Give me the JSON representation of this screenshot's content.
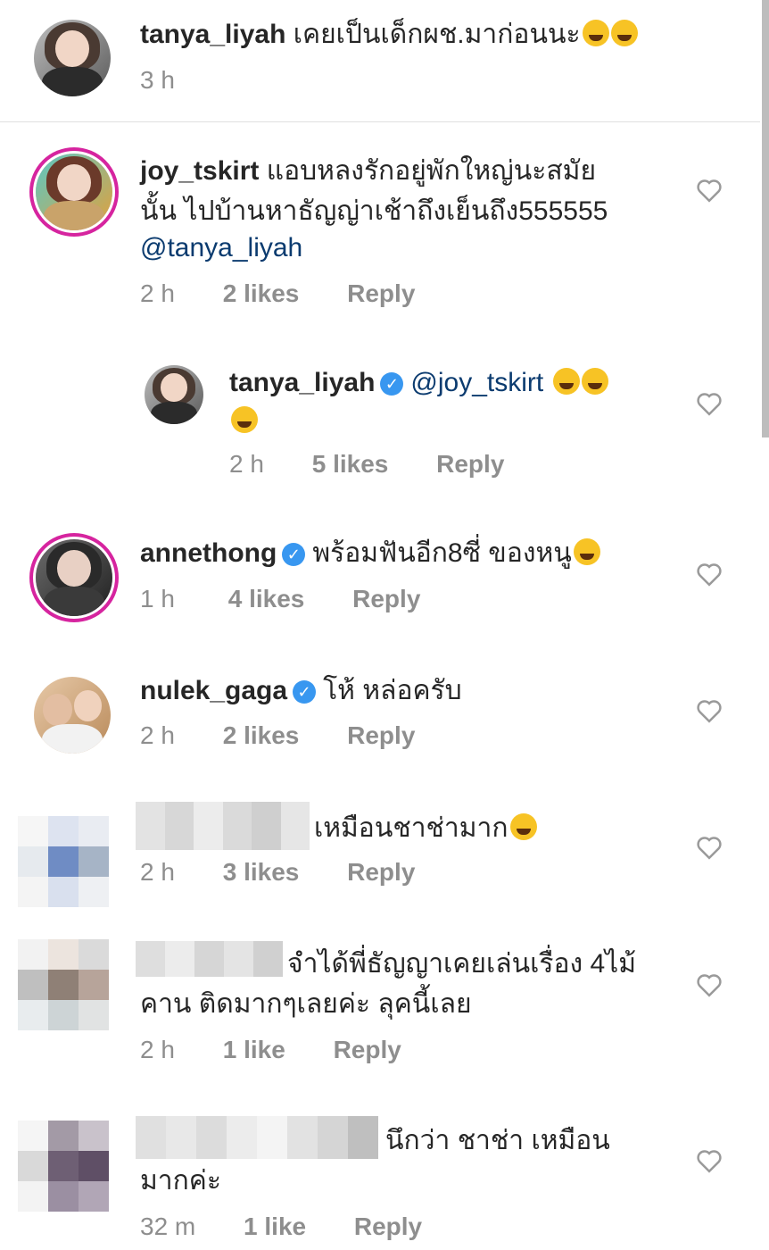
{
  "comments": [
    {
      "username": "tanya_liyah",
      "text": "เคยเป็นเด็กผช.มาก่อนนะ",
      "time": "3 h"
    },
    {
      "username": "joy_tskirt",
      "text_line1": "แอบหลงรักอยู่พักใหญ่นะสมัย",
      "text_line2": "นั้น ไปบ้านหาธัญญ่าเช้าถึงเย็นถึง555555",
      "mention": "@tanya_liyah",
      "time": "2 h",
      "likes": "2 likes",
      "reply": "Reply"
    },
    {
      "username": "tanya_liyah",
      "mention": "@joy_tskirt",
      "time": "2 h",
      "likes": "5 likes",
      "reply": "Reply"
    },
    {
      "username": "annethong",
      "text": "พร้อมฟันอีก8ซี่ ของหนู",
      "time": "1 h",
      "likes": "4 likes",
      "reply": "Reply"
    },
    {
      "username": "nulek_gaga",
      "text": "โห้ หล่อครับ",
      "time": "2 h",
      "likes": "2 likes",
      "reply": "Reply"
    },
    {
      "text": "เหมือนชาช่ามาก",
      "time": "2 h",
      "likes": "3 likes",
      "reply": "Reply"
    },
    {
      "text_line1": "จำได้พี่ธัญญาเคยเล่นเรื่อง 4ไม้",
      "text_line2": "คาน ติดมากๆเลยค่ะ ลุคนี้เลย",
      "time": "2 h",
      "likes": "1 like",
      "reply": "Reply"
    },
    {
      "text_line1": "นึกว่า ชาช่า เหมือน",
      "text_line2": "มากค่ะ",
      "time": "32 m",
      "likes": "1 like",
      "reply": "Reply"
    }
  ],
  "icons": {
    "heart": "heart-outline-icon",
    "verified": "verified-badge-icon",
    "emoji_rofl": "rolling-laughing-emoji",
    "emoji_joy": "tears-of-joy-emoji",
    "emoji_grin": "grinning-emoji"
  },
  "colors": {
    "username": "#262626",
    "mention": "#0b3b6f",
    "meta": "#8e8e8e",
    "verified": "#3897f0",
    "story_ring": "#d6249f"
  }
}
